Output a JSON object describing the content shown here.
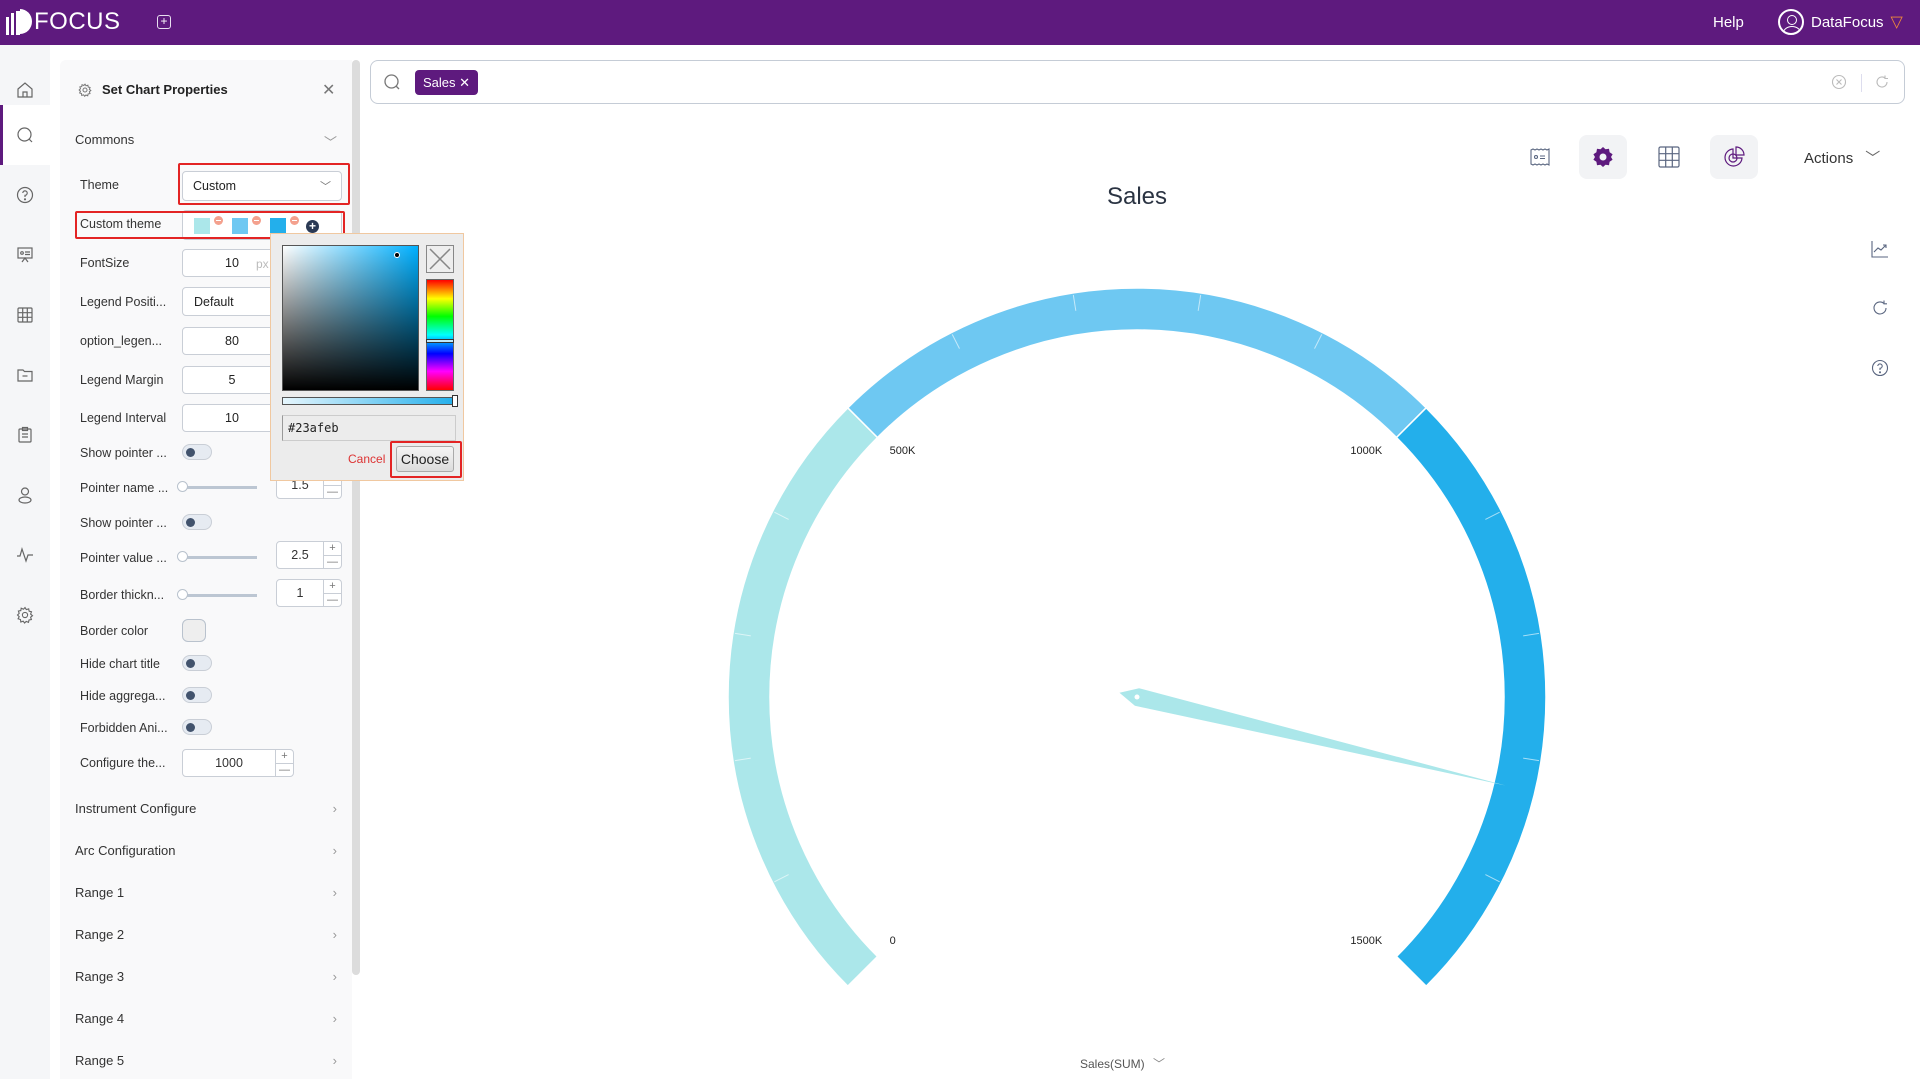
{
  "topbar": {
    "logo": "FOCUS",
    "help": "Help",
    "user": "DataFocus"
  },
  "nav": [
    "home-icon",
    "search-icon",
    "question-icon",
    "presentation-icon",
    "table-icon",
    "folder-icon",
    "clipboard-icon",
    "user-icon",
    "pulse-icon",
    "gear-icon"
  ],
  "panel": {
    "title": "Set Chart Properties",
    "commons": "Commons",
    "theme_label": "Theme",
    "theme_value": "Custom",
    "custom_theme_label": "Custom theme",
    "custom_theme_colors": [
      "#abe7ea",
      "#6ec8f2",
      "#23afeb"
    ],
    "fontsize_label": "FontSize",
    "fontsize_value": "10",
    "fontsize_unit": "px",
    "legend_position_label": "Legend Positi...",
    "legend_position_value": "Default",
    "option_legend_label": "option_legen...",
    "option_legend_value": "80",
    "legend_margin_label": "Legend Margin",
    "legend_margin_value": "5",
    "legend_interval_label": "Legend Interval",
    "legend_interval_value": "10",
    "show_pointer_1_label": "Show pointer ...",
    "pointer_name_label": "Pointer name ...",
    "pointer_name_value": "1.5",
    "show_pointer_2_label": "Show pointer ...",
    "pointer_value_label": "Pointer value ...",
    "pointer_value_value": "2.5",
    "border_thickness_label": "Border thickn...",
    "border_thickness_value": "1",
    "border_color_label": "Border color",
    "hide_chart_title_label": "Hide chart title",
    "hide_aggregation_label": "Hide aggrega...",
    "forbidden_animation_label": "Forbidden Ani...",
    "configure_label": "Configure the...",
    "configure_value": "1000",
    "sections": [
      "Instrument Configure",
      "Arc Configuration",
      "Range 1",
      "Range 2",
      "Range 3",
      "Range 4",
      "Range 5"
    ]
  },
  "picker": {
    "hex": "#23afeb",
    "cancel": "Cancel",
    "choose": "Choose"
  },
  "search": {
    "token": "Sales"
  },
  "toolbar": {
    "actions": "Actions"
  },
  "chart_data": {
    "type": "gauge",
    "title": "Sales",
    "min": 0,
    "max": 1500000,
    "value": 1325000,
    "tick_labels": [
      "0",
      "500K",
      "1000K",
      "1500K"
    ],
    "ranges": [
      {
        "from": 0,
        "to": 500000,
        "color": "#abe7ea"
      },
      {
        "from": 500000,
        "to": 1000000,
        "color": "#6ec8f2"
      },
      {
        "from": 1000000,
        "to": 1500000,
        "color": "#23afeb"
      }
    ],
    "pointer_color": "#abe7ea",
    "footer": "Sales(SUM)"
  }
}
